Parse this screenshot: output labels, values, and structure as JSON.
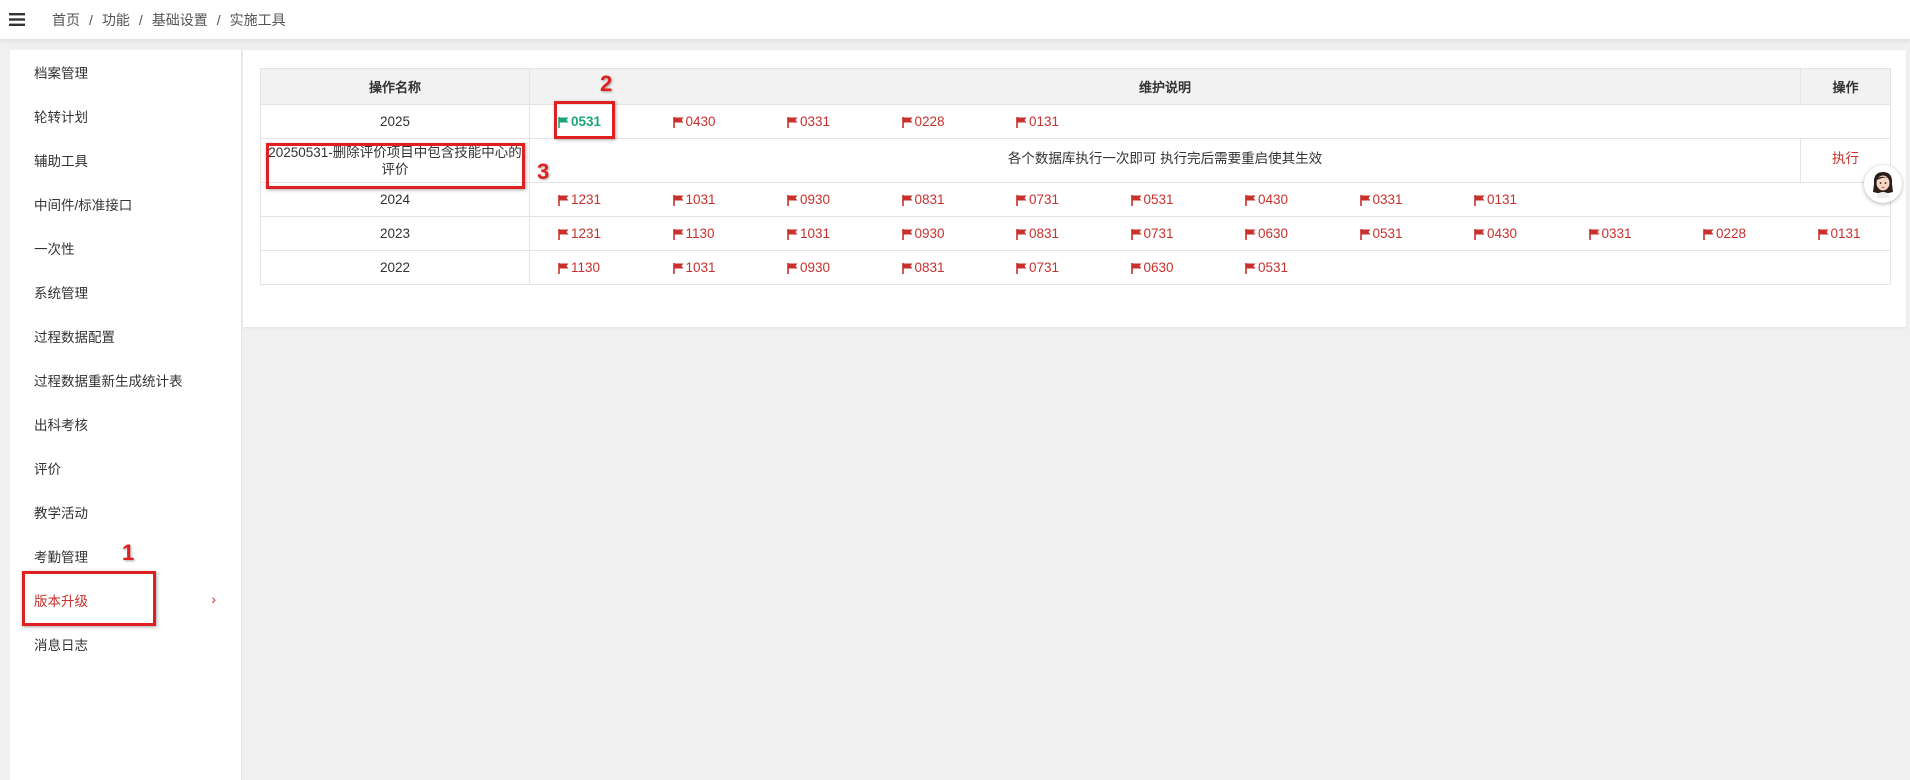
{
  "breadcrumb": {
    "items": [
      "首页",
      "功能",
      "基础设置",
      "实施工具"
    ],
    "separator": "/"
  },
  "sidebar": {
    "items": [
      {
        "label": "档案管理"
      },
      {
        "label": "轮转计划"
      },
      {
        "label": "辅助工具"
      },
      {
        "label": "中间件/标准接口"
      },
      {
        "label": "一次性"
      },
      {
        "label": "系统管理"
      },
      {
        "label": "过程数据配置"
      },
      {
        "label": "过程数据重新生成统计表"
      },
      {
        "label": "出科考核"
      },
      {
        "label": "评价"
      },
      {
        "label": "教学活动"
      },
      {
        "label": "考勤管理"
      },
      {
        "label": "版本升级",
        "active": true,
        "arrow": "›"
      },
      {
        "label": "消息日志"
      }
    ]
  },
  "table": {
    "headers": [
      "操作名称",
      "维护说明",
      "操作"
    ],
    "rows": [
      {
        "name": "2025",
        "versions": [
          "0531",
          "0430",
          "0331",
          "0228",
          "0131"
        ],
        "current": "0531"
      },
      {
        "name": "20250531-删除评价项目中包含技能中心的评价",
        "description": "各个数据库执行一次即可 执行完后需要重启使其生效",
        "action": "执行"
      },
      {
        "name": "2024",
        "versions": [
          "1231",
          "1031",
          "0930",
          "0831",
          "0731",
          "0531",
          "0430",
          "0331",
          "0131"
        ]
      },
      {
        "name": "2023",
        "versions": [
          "1231",
          "1130",
          "1031",
          "0930",
          "0831",
          "0731",
          "0630",
          "0531",
          "0430",
          "0331",
          "0228",
          "0131"
        ]
      },
      {
        "name": "2022",
        "versions": [
          "1130",
          "1031",
          "0930",
          "0831",
          "0731",
          "0630",
          "0531"
        ]
      }
    ]
  },
  "annotations": [
    "1",
    "2",
    "3"
  ],
  "colors": {
    "accent": "#c9302c",
    "current_version": "#1aa57a",
    "annotation": "#e02020"
  },
  "icons": {
    "menu": "hamburger-icon",
    "version": "flag-icon",
    "assistant": "avatar-icon"
  }
}
